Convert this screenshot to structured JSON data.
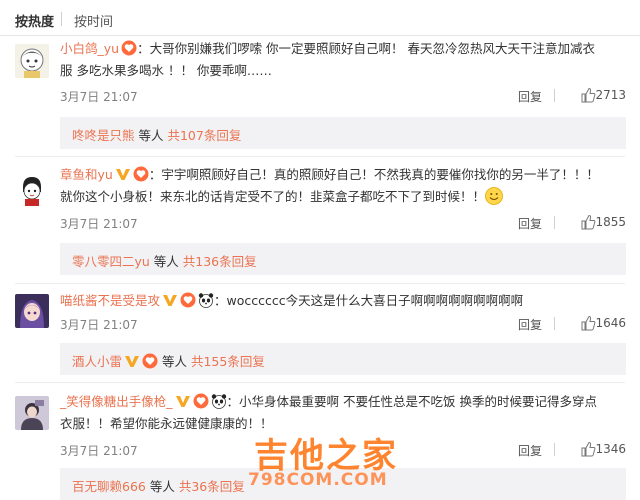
{
  "tabs": {
    "hot": "按热度",
    "time": "按时间"
  },
  "comments": [
    {
      "user": "小白鸽_yu",
      "line1": "：大哥你别嫌我们啰嗦 你一定要照顾好自己啊！ 春天忽冷忽热风大天干注意加减衣",
      "line2": "服 多吃水果多喝水 ！！ 你要乖啊……",
      "date": "3月7日 21:07",
      "reply": "回复",
      "likes": "2713",
      "sub": {
        "user": "咚咚是只熊",
        "mid": " 等人 ",
        "more": "共107条回复"
      }
    },
    {
      "user": "章鱼和yu",
      "line1": "：宇宇啊照顾好自己！真的照顾好自己！不然我真的要催你找你的另一半了！！！",
      "line2": "就你这个小身板！来东北的话肯定受不了的！韭菜盒子都吃不下了到时候！！",
      "date": "3月7日 21:07",
      "reply": "回复",
      "likes": "1855",
      "sub": {
        "user": "零八零四二yu",
        "mid": " 等人 ",
        "more": "共136条回复"
      }
    },
    {
      "user": "喵纸酱不是受是攻",
      "line1": "：wocccccc今天这是什么大喜日子啊啊啊啊啊啊啊啊啊",
      "date": "3月7日 21:07",
      "reply": "回复",
      "likes": "1646",
      "sub": {
        "user": "酒人小雷",
        "mid": " 等人 ",
        "more": "共155条回复"
      }
    },
    {
      "user": "_笑得像糖出手像枪_",
      "line1": "：小华身体最重要啊 不要任性总是不吃饭 换季的时候要记得多穿点",
      "line2": "衣服！！希望你能永远健健康康的！！",
      "date": "3月7日 21:07",
      "reply": "回复",
      "likes": "1346",
      "sub": {
        "user": "百无聊赖666",
        "mid": " 等人 ",
        "more": "共36条回复"
      }
    }
  ],
  "watermark": {
    "main": "吉他之家",
    "sub": "798COM.COM"
  },
  "colors": {
    "username": "#eb7350",
    "subBg": "#f2f2f5",
    "meta": "#808080"
  },
  "icons": [
    "like-thumb-icon",
    "vip-v-icon",
    "heart-badge-icon",
    "panda-icon",
    "smile-emoji-icon"
  ]
}
